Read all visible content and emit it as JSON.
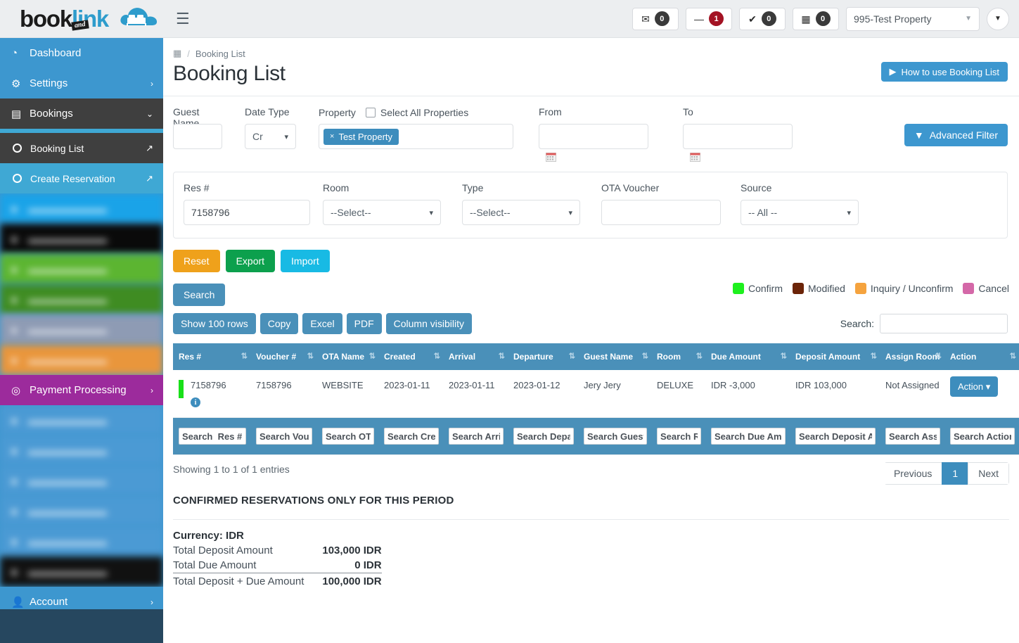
{
  "brand": {
    "book": "book",
    "link": "link",
    "and": "and"
  },
  "topbar": {
    "badges": [
      {
        "icon": "envelope-icon",
        "glyph": "✉",
        "count": "0",
        "style": "dark"
      },
      {
        "icon": "minus-icon",
        "glyph": "—",
        "count": "1",
        "style": "danger"
      },
      {
        "icon": "check-icon",
        "glyph": "✔",
        "count": "0",
        "style": "dark"
      },
      {
        "icon": "calendar-icon",
        "glyph": "▦",
        "count": "0",
        "style": "dark"
      }
    ],
    "property_selected": "995-Test Property",
    "user_menu_caret": "▼"
  },
  "sidebar": {
    "items": [
      {
        "label": "Dashboard",
        "icon": "dashboard-icon",
        "glyph": "◔",
        "chev": ""
      },
      {
        "label": "Settings",
        "icon": "gear-icon",
        "glyph": "⚙",
        "chev": "›"
      },
      {
        "label": "Bookings",
        "icon": "bookings-icon",
        "glyph": "▤",
        "chev": "⌄",
        "active": true
      }
    ],
    "sub_items": [
      {
        "label": "Booking List",
        "active": true,
        "ext": "↗"
      },
      {
        "label": "Create Reservation",
        "active": false,
        "ext": "↗"
      }
    ],
    "payment_processing": {
      "label": "Payment Processing",
      "icon": "target-icon",
      "glyph": "◎",
      "chev": "›"
    },
    "account": {
      "label": "Account",
      "icon": "user-icon",
      "glyph": "●",
      "chev": "›"
    },
    "blurred_upper": [
      {
        "color": "#1aa3e8"
      },
      {
        "color": "#0a0a0a"
      },
      {
        "color": "#5cb531"
      },
      {
        "color": "#3f8c22"
      },
      {
        "color": "#8e9bb4"
      },
      {
        "color": "#e9963c"
      }
    ],
    "blurred_lower": [
      {
        "color": "#4b9ad4"
      },
      {
        "color": "#4b9ad4"
      },
      {
        "color": "#4b9ad4"
      },
      {
        "color": "#4b9ad4"
      },
      {
        "color": "#4b9ad4"
      },
      {
        "color": "#111111"
      }
    ]
  },
  "breadcrumb": {
    "home_icon": "page-icon",
    "sep": "/",
    "current": "Booking List"
  },
  "page": {
    "title": "Booking List",
    "howto_label": "How to use Booking List",
    "howto_icon": "play-icon"
  },
  "filters": {
    "guest_name": {
      "label": "Guest Name",
      "value": "",
      "placeholder": ""
    },
    "date_type": {
      "label": "Date Type",
      "value": "Cr"
    },
    "property": {
      "label": "Property",
      "select_all_label": "Select All Properties",
      "select_all_checked": false,
      "tags": [
        {
          "label": "Test Property",
          "remove": "×"
        }
      ]
    },
    "from": {
      "label": "From",
      "value": "",
      "calendar_icon": "calendar-icon"
    },
    "to": {
      "label": "To",
      "value": "",
      "calendar_icon": "calendar-icon"
    },
    "advanced_filter": {
      "label": "Advanced Filter",
      "icon": "funnel-icon"
    },
    "res_no": {
      "label": "Res #",
      "value": "7158796"
    },
    "room": {
      "label": "Room",
      "value": "--Select--"
    },
    "type": {
      "label": "Type",
      "value": "--Select--"
    },
    "ota_voucher": {
      "label": "OTA Voucher",
      "value": ""
    },
    "source": {
      "label": "Source",
      "value": "-- All --"
    }
  },
  "actions": {
    "reset": "Reset",
    "export": "Export",
    "import": "Import",
    "search": "Search"
  },
  "legend": [
    {
      "label": "Confirm",
      "color": "#1ef01e"
    },
    {
      "label": "Modified",
      "color": "#6b2408"
    },
    {
      "label": "Inquiry / Unconfirm",
      "color": "#f5a33e"
    },
    {
      "label": "Cancel",
      "color": "#d468a8"
    }
  ],
  "datatable": {
    "buttons": [
      "Show 100 rows",
      "Copy",
      "Excel",
      "PDF",
      "Column visibility"
    ],
    "search_label": "Search:",
    "search_value": "",
    "columns": [
      "Res #",
      "Voucher #",
      "OTA Name",
      "Created",
      "Arrival",
      "Departure",
      "Guest Name",
      "Room",
      "Due Amount",
      "Deposit Amount",
      "Assign Room",
      "Action"
    ],
    "sort_glyph": "⇅",
    "rows": [
      {
        "status_color": "#19e019",
        "res_no": "7158796",
        "info_icon": "info-icon",
        "voucher_no": "7158796",
        "ota_name": "WEBSITE",
        "created": "2023-01-11",
        "arrival": "2023-01-11",
        "departure": "2023-01-12",
        "guest_name": "Jery Jery",
        "room": "DELUXE",
        "due_amount": "IDR -3,000",
        "deposit_amount": "IDR 103,000",
        "assign_room": "Not Assigned",
        "action_label": "Action",
        "action_caret": "▾"
      }
    ],
    "column_search_placeholders": [
      "Search  Res #",
      "Search Voucher #",
      "Search OTA Name",
      "Search Created",
      "Search Arrival",
      "Search Departure",
      "Search Guest Name",
      "Search Room",
      "Search Due Amount",
      "Search Deposit Amount",
      "Search Assign Room",
      "Search Action"
    ],
    "showing": "Showing 1 to 1 of 1 entries",
    "pagination": {
      "previous": "Previous",
      "pages": [
        "1"
      ],
      "next": "Next",
      "current": "1"
    }
  },
  "summary": {
    "heading": "CONFIRMED RESERVATIONS ONLY FOR THIS PERIOD",
    "currency_label": "Currency: IDR",
    "rows": [
      {
        "label": "Total Deposit Amount",
        "value": "103,000 IDR"
      },
      {
        "label": "Total Due Amount",
        "value": "0 IDR"
      }
    ],
    "total": {
      "label": "Total Deposit + Due Amount",
      "value": "100,000 IDR"
    }
  }
}
